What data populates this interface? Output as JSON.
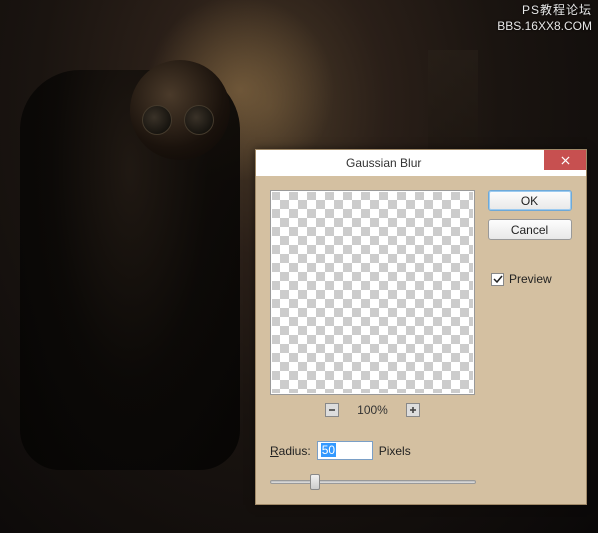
{
  "watermark": {
    "line1": "PS教程论坛",
    "line2": "BBS.16XX8.COM"
  },
  "dialog": {
    "title": "Gaussian Blur",
    "ok": "OK",
    "cancel": "Cancel",
    "preview_label": "Preview",
    "preview_checked": true,
    "zoom_pct": "100%",
    "radius_label": "Radius:",
    "radius_value": "50",
    "radius_units": "Pixels",
    "radius_hotkey": "R"
  }
}
